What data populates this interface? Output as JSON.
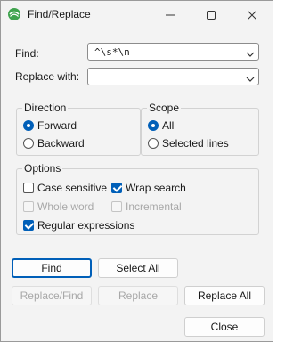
{
  "window": {
    "title": "Find/Replace",
    "icons": {
      "app": "eclipse-icon",
      "minimize": "minimize-icon",
      "maximize": "maximize-icon",
      "close": "close-icon"
    }
  },
  "find": {
    "label": "Find:",
    "value": "^\\s*\\n"
  },
  "replace": {
    "label": "Replace with:",
    "value": ""
  },
  "direction": {
    "title": "Direction",
    "forward": "Forward",
    "backward": "Backward",
    "selected": "Forward"
  },
  "scope": {
    "title": "Scope",
    "all": "All",
    "selected_lines": "Selected lines",
    "selected": "All"
  },
  "options": {
    "title": "Options",
    "case_sensitive": {
      "label": "Case sensitive",
      "checked": false,
      "enabled": true
    },
    "wrap_search": {
      "label": "Wrap search",
      "checked": true,
      "enabled": true
    },
    "whole_word": {
      "label": "Whole word",
      "checked": false,
      "enabled": false
    },
    "incremental": {
      "label": "Incremental",
      "checked": false,
      "enabled": false
    },
    "regular_expressions": {
      "label": "Regular expressions",
      "checked": true,
      "enabled": true
    }
  },
  "buttons": {
    "find": "Find",
    "select_all": "Select All",
    "replace_find": "Replace/Find",
    "replace": "Replace",
    "replace_all": "Replace All",
    "close": "Close"
  },
  "colors": {
    "accent": "#005fb8",
    "disabled_text": "#a8a8a8"
  }
}
